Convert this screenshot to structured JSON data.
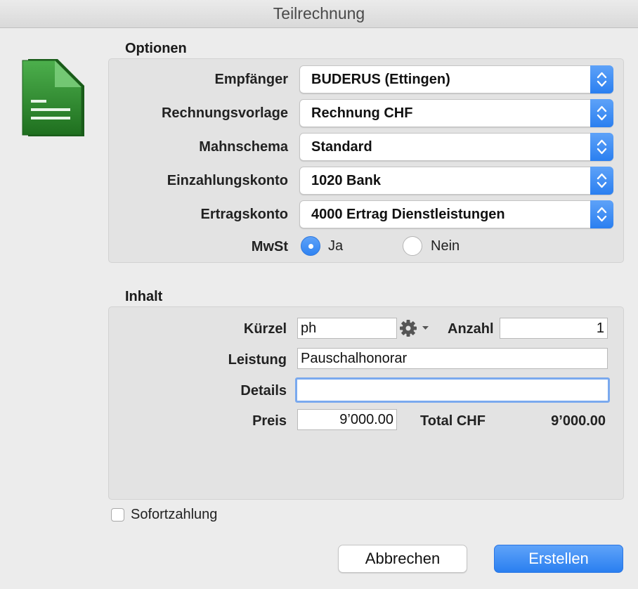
{
  "window": {
    "title": "Teilrechnung"
  },
  "icon": {
    "name": "document-icon",
    "color": "#2e8b2e"
  },
  "optionen": {
    "title": "Optionen",
    "empfaenger": {
      "label": "Empfänger",
      "value": "BUDERUS (Ettingen)"
    },
    "rechnungsvorlage": {
      "label": "Rechnungsvorlage",
      "value": "Rechnung CHF"
    },
    "mahnschema": {
      "label": "Mahnschema",
      "value": "Standard"
    },
    "einzahlungskonto": {
      "label": "Einzahlungskonto",
      "value": "1020 Bank"
    },
    "ertragskonto": {
      "label": "Ertragskonto",
      "value": "4000 Ertrag Dienstleistungen"
    },
    "mwst": {
      "label": "MwSt",
      "options": [
        "Ja",
        "Nein"
      ],
      "selected": "Ja"
    }
  },
  "inhalt": {
    "title": "Inhalt",
    "kuerzel": {
      "label": "Kürzel",
      "value": "ph"
    },
    "anzahl": {
      "label": "Anzahl",
      "value": "1"
    },
    "leistung": {
      "label": "Leistung",
      "value": "Pauschalhonorar"
    },
    "details": {
      "label": "Details",
      "value": ""
    },
    "preis": {
      "label": "Preis",
      "value": "9’000.00"
    },
    "total": {
      "label": "Total CHF",
      "value": "9’000.00"
    }
  },
  "sofortzahlung": {
    "label": "Sofortzahlung",
    "checked": false
  },
  "buttons": {
    "cancel": "Abbrechen",
    "create": "Erstellen"
  },
  "colors": {
    "accent": "#2f83f2",
    "background": "#ececec",
    "groupbox": "#e3e3e3"
  }
}
